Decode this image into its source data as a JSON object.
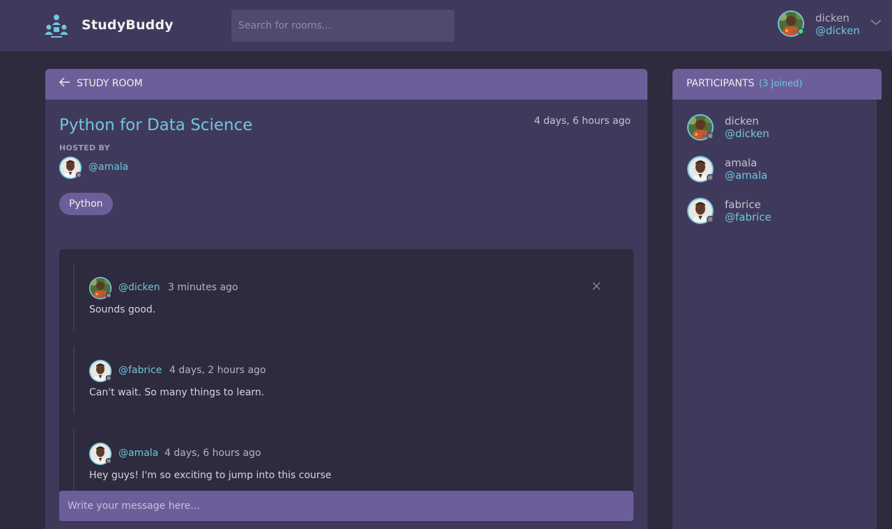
{
  "app": {
    "name": "StudyBuddy"
  },
  "header": {
    "search_placeholder": "Search for rooms...",
    "user": {
      "name": "dicken",
      "handle": "@dicken",
      "status": "online"
    }
  },
  "room": {
    "section_label": "STUDY ROOM",
    "title": "Python for Data Science",
    "created": "4 days, 6 hours ago",
    "hosted_by_label": "HOSTED BY",
    "host_handle": "@amala",
    "topic": "Python",
    "messages": [
      {
        "handle": "@dicken",
        "time": "3 minutes ago",
        "text": "Sounds good.",
        "deletable": true
      },
      {
        "handle": "@fabrice",
        "time": "4 days, 2 hours ago",
        "text": "Can't wait. So many things to learn.",
        "deletable": false
      },
      {
        "handle": "@amala",
        "time": "4 days, 6 hours ago",
        "text": "Hey guys! I'm so exciting to jump into this course",
        "deletable": false
      }
    ],
    "composer_placeholder": "Write your message here..."
  },
  "participants": {
    "title": "PARTICIPANTS",
    "count_label": "(3 Joined)",
    "list": [
      {
        "name": "dicken",
        "handle": "@dicken"
      },
      {
        "name": "amala",
        "handle": "@amala"
      },
      {
        "name": "fabrice",
        "handle": "@fabrice"
      }
    ]
  },
  "colors": {
    "accent": "#71c6dd",
    "header_bg": "#3f3a5c",
    "panel_head": "#6c5f99",
    "page_bg": "#2d2b3d",
    "online": "#4ade80",
    "offline": "#8b8794"
  }
}
